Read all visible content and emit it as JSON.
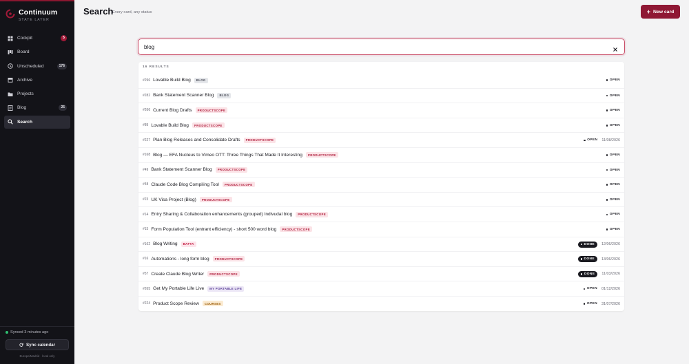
{
  "app": {
    "name": "Continuum",
    "subtitle": "STATE LAYER"
  },
  "header": {
    "title": "Search",
    "subtitle": "Every card, any status",
    "new_card_label": "New card"
  },
  "sidebar": {
    "items": [
      {
        "label": "Cockpit",
        "badge": "5",
        "icon": "grid-icon"
      },
      {
        "label": "Board",
        "badge": "",
        "icon": "board-icon"
      },
      {
        "label": "Unscheduled",
        "badge": "176",
        "icon": "clock-icon"
      },
      {
        "label": "Archive",
        "badge": "",
        "icon": "archive-icon"
      },
      {
        "label": "Projects",
        "badge": "",
        "icon": "folder-icon"
      },
      {
        "label": "Blog",
        "badge": "25",
        "icon": "document-icon"
      },
      {
        "label": "Search",
        "badge": "",
        "icon": "search-icon"
      }
    ],
    "synced": "Synced 3 minutes ago",
    "sync_button": "Sync calendar",
    "timezone": "Europe/Madrid · local only"
  },
  "search": {
    "value": "blog",
    "results_count": "16 RESULTS"
  },
  "colors": {
    "accent": "#8f1834",
    "sidebar_bg": "#131318",
    "tag_blog_bg": "#e4e6ea",
    "tag_productscope_bg": "#fbe3e7",
    "tag_bafta_bg": "#fde4ea",
    "tag_portable_bg": "#ece7f6",
    "tag_courses_bg": "#fbebd2"
  },
  "results": [
    {
      "num": "#296",
      "title": "Lovable Build Blog",
      "tag": "BLOG",
      "tag_type": "blog",
      "status": "OPEN",
      "date": ""
    },
    {
      "num": "#282",
      "title": "Bank Statement Scanner Blog",
      "tag": "BLOG",
      "tag_type": "blog",
      "status": "OPEN",
      "date": ""
    },
    {
      "num": "#266",
      "title": "Current Blog Drafts",
      "tag": "PRODUCTSCOPE",
      "tag_type": "productscope",
      "status": "OPEN",
      "date": ""
    },
    {
      "num": "#89",
      "title": "Lovable Build Blog",
      "tag": "PRODUCTSCOPE",
      "tag_type": "productscope",
      "status": "OPEN",
      "date": ""
    },
    {
      "num": "#227",
      "title": "Plan Blog Releases and Consolidate Drafts",
      "tag": "PRODUCTSCOPE",
      "tag_type": "productscope",
      "status": "OPEN",
      "date": "11/08/2026"
    },
    {
      "num": "#168",
      "title": "Blog — EFA Nucleus to Vimeo OTT: Three Things That Made It Interesting",
      "tag": "PRODUCTSCOPE",
      "tag_type": "productscope",
      "status": "OPEN",
      "date": ""
    },
    {
      "num": "#49",
      "title": "Bank Statement Scanner Blog",
      "tag": "PRODUCTSCOPE",
      "tag_type": "productscope",
      "status": "OPEN",
      "date": ""
    },
    {
      "num": "#48",
      "title": "Claude Code Blog Compiling Tool",
      "tag": "PRODUCTSCOPE",
      "tag_type": "productscope",
      "status": "OPEN",
      "date": ""
    },
    {
      "num": "#23",
      "title": "UK Visa Project (Blog)",
      "tag": "PRODUCTSCOPE",
      "tag_type": "productscope",
      "status": "OPEN",
      "date": ""
    },
    {
      "num": "#14",
      "title": "Entry Sharing & Collaboration enhancements (grouped) Indivudal blog",
      "tag": "PRODUCTSCOPE",
      "tag_type": "productscope",
      "status": "OPEN",
      "date": ""
    },
    {
      "num": "#15",
      "title": "Form Population Tool (entrant efficiency) - short 500 word blog",
      "tag": "PRODUCTSCOPE",
      "tag_type": "productscope",
      "status": "OPEN",
      "date": ""
    },
    {
      "num": "#162",
      "title": "Blog Writing",
      "tag": "BAFTA",
      "tag_type": "bafta",
      "status": "DONE",
      "date": "12/06/2026"
    },
    {
      "num": "#16",
      "title": "Automations - long form blog",
      "tag": "PRODUCTSCOPE",
      "tag_type": "productscope",
      "status": "DONE",
      "date": "13/06/2026"
    },
    {
      "num": "#57",
      "title": "Create Claude Blog Writer",
      "tag": "PRODUCTSCOPE",
      "tag_type": "productscope",
      "status": "DONE",
      "date": "11/03/2026"
    },
    {
      "num": "#265",
      "title": "Get My Portable Life Live",
      "tag": "MY PORTABLE LIFE",
      "tag_type": "portable",
      "status": "OPEN",
      "date": "01/12/2026"
    },
    {
      "num": "#224",
      "title": "Product Scope Review",
      "tag": "COURSES",
      "tag_type": "courses",
      "status": "OPEN",
      "date": "31/07/2026"
    }
  ]
}
